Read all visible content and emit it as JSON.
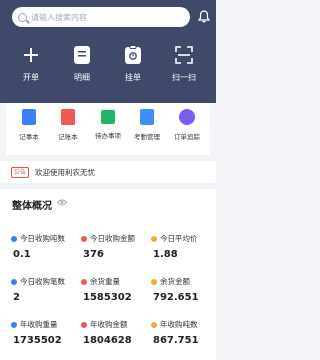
{
  "search": {
    "placeholder": "请输入搜索内容",
    "icon": "search-icon"
  },
  "header": {
    "bell_icon": "bell-icon",
    "bg": "#3f4a6b"
  },
  "actions": [
    {
      "label": "开单",
      "icon": "plus-icon"
    },
    {
      "label": "明细",
      "icon": "list-icon"
    },
    {
      "label": "挂单",
      "icon": "clipboard-icon"
    },
    {
      "label": "扫一扫",
      "icon": "scan-icon"
    }
  ],
  "menu": [
    {
      "label": "记事本",
      "icon": "notepad-icon",
      "color": "#3d7ff5"
    },
    {
      "label": "记账本",
      "icon": "ledger-icon",
      "color": "#ef5a4f"
    },
    {
      "label": "待办事项",
      "icon": "todo-icon",
      "color": "#25b36b"
    },
    {
      "label": "考勤管理",
      "icon": "calendar-icon",
      "color": "#3d8ff5"
    },
    {
      "label": "订单追踪",
      "icon": "order-track-icon",
      "color": "#7a5cf0"
    }
  ],
  "notice": {
    "badge": "公告",
    "text": "欢迎使用利农无忧"
  },
  "overview": {
    "title": "整体概况",
    "stats": [
      {
        "label": "今日收购吨数",
        "value": "0.1",
        "color": "#3d7ff5"
      },
      {
        "label": "今日收购金额",
        "value": "376",
        "color": "#ef5a4f"
      },
      {
        "label": "今日平均价",
        "value": "1.88",
        "color": "#f2a93b"
      },
      {
        "label": "今日收购笔数",
        "value": "2",
        "color": "#3d7ff5"
      },
      {
        "label": "余货重量",
        "value": "1585302",
        "color": "#ef5a4f"
      },
      {
        "label": "余货金额",
        "value": "792.651",
        "color": "#f2a93b"
      },
      {
        "label": "年收购重量",
        "value": "1735502",
        "color": "#3d7ff5"
      },
      {
        "label": "年收购金额",
        "value": "1804628",
        "color": "#ef5a4f"
      },
      {
        "label": "年收购吨数",
        "value": "867.751",
        "color": "#f2a93b"
      }
    ]
  }
}
